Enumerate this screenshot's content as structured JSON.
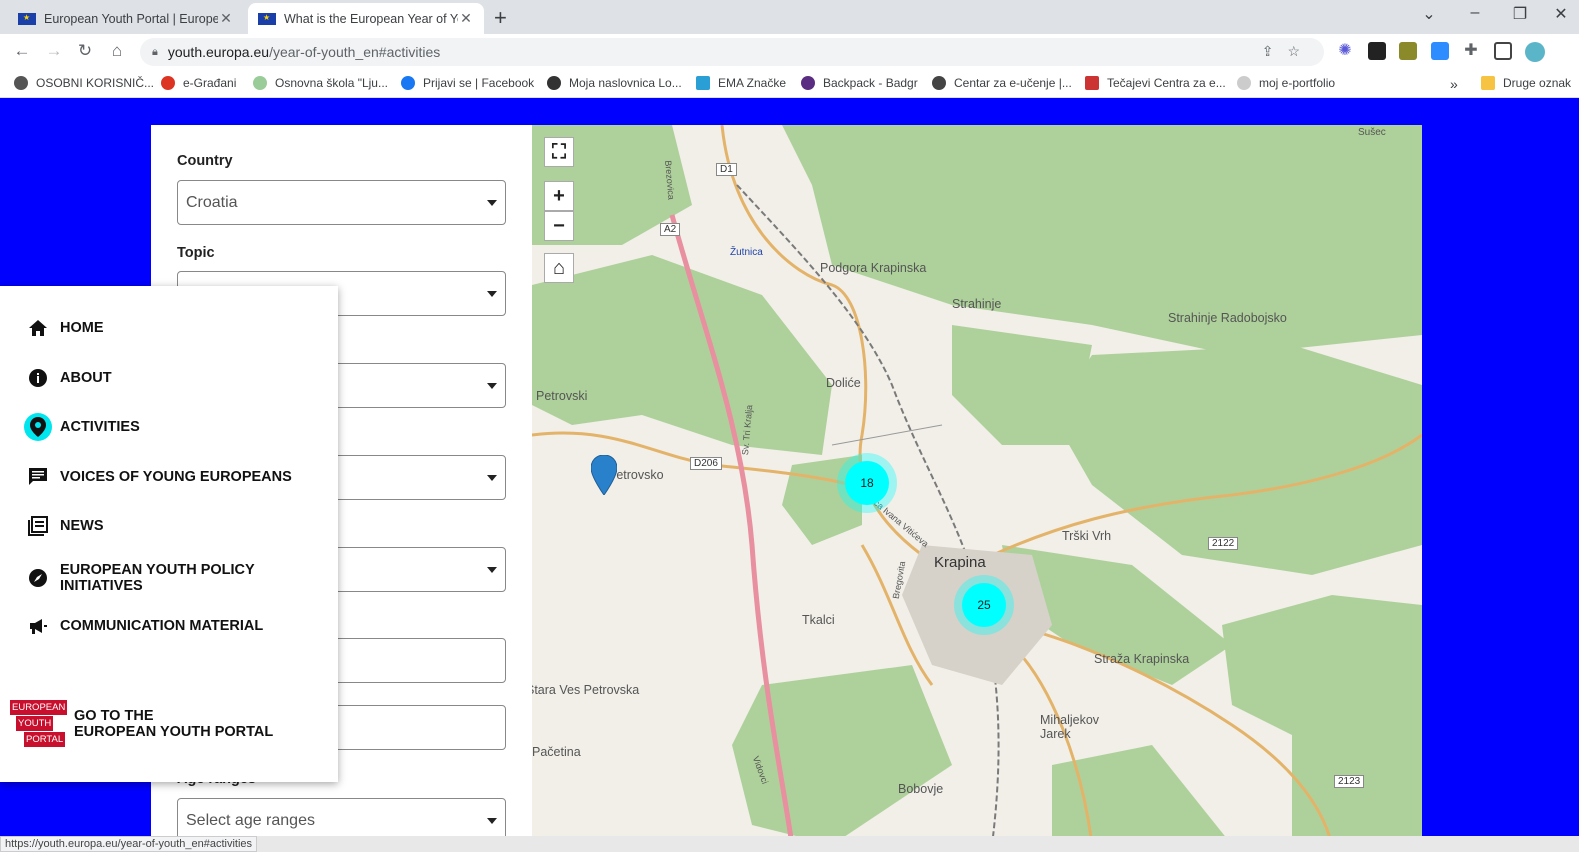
{
  "browser": {
    "tabs": [
      {
        "title": "European Youth Portal | European",
        "active": false
      },
      {
        "title": "What is the European Year of Yout",
        "active": true
      }
    ],
    "url_host": "youth.europa.eu",
    "url_path": "/year-of-youth_en#activities",
    "bookmarks": [
      "OSOBNI KORISNIČ...",
      "e-Građani",
      "Osnovna škola \"Lju...",
      "Prijavi se | Facebook",
      "Moja naslovnica Lo...",
      "EMA Značke",
      "Backpack - Badgr",
      "Centar za e-učenje |...",
      "Tečajevi Centra za e...",
      "moj e-portfolio",
      "Druge oznak"
    ],
    "status_url": "https://youth.europa.eu/year-of-youth_en#activities"
  },
  "filters": {
    "country_label": "Country",
    "country_value": "Croatia",
    "topic_label": "Topic",
    "age_label": "Age ranges",
    "age_placeholder": "Select age ranges"
  },
  "menu": {
    "items": [
      {
        "label": "HOME",
        "icon": "home-icon"
      },
      {
        "label": "ABOUT",
        "icon": "info-icon"
      },
      {
        "label": "ACTIVITIES",
        "icon": "map-pin-icon"
      },
      {
        "label": "VOICES OF YOUNG EUROPEANS",
        "icon": "chat-icon"
      },
      {
        "label": "NEWS",
        "icon": "news-icon"
      },
      {
        "label": "EUROPEAN YOUTH POLICY INITIATIVES",
        "icon": "compass-icon"
      },
      {
        "label": "COMMUNICATION MATERIAL",
        "icon": "megaphone-icon"
      }
    ],
    "portal_line1": "GO TO THE",
    "portal_line2": "EUROPEAN YOUTH PORTAL",
    "logo_lines": [
      "EUROPEAN",
      "YOUTH",
      "PORTAL"
    ]
  },
  "map": {
    "clusters": [
      {
        "count": "18"
      },
      {
        "count": "25"
      }
    ],
    "places": [
      "Sušec",
      "Podgora Krapinska",
      "Strahinje",
      "Strahinje Radobojsko",
      "Žutnica",
      "Doliće",
      "Petrovski",
      "Petrovsko",
      "Krapina",
      "Tkalci",
      "Trški Vrh",
      "Straža Krapinska",
      "Mihaljekov Jarek",
      "Pačetina",
      "Bobovje",
      "Stara Ves Petrovska",
      "Brezovica",
      "Sv. Tri Kralja",
      "Vidovci",
      "Bregovita",
      "Ulica Ivana Vitićeva"
    ],
    "roads": [
      "D1",
      "A2",
      "D206",
      "2122",
      "2123"
    ]
  },
  "colors": {
    "page_bg": "#0000ff",
    "accent": "#00ffff",
    "forest": "#aed19b"
  }
}
